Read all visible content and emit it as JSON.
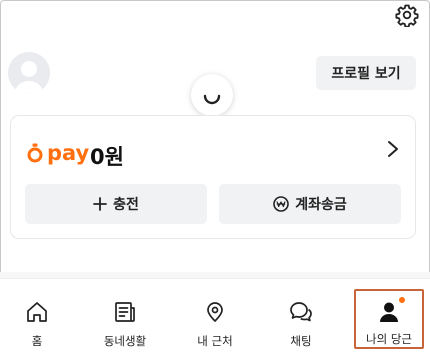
{
  "header": {
    "settings_icon": "gear-icon",
    "profile_button_label": "프로필 보기"
  },
  "pay": {
    "brand": "pay",
    "amount": "0원",
    "charge_label": "충전",
    "transfer_label": "계좌송금",
    "accent_color": "#ff6f0f"
  },
  "tabs": [
    {
      "label": "홈",
      "icon": "home-icon"
    },
    {
      "label": "동네생활",
      "icon": "community-icon"
    },
    {
      "label": "내 근처",
      "icon": "location-pin-icon"
    },
    {
      "label": "채팅",
      "icon": "chat-icon"
    },
    {
      "label": "나의 당근",
      "icon": "person-icon",
      "selected": true,
      "has_badge": true
    }
  ]
}
